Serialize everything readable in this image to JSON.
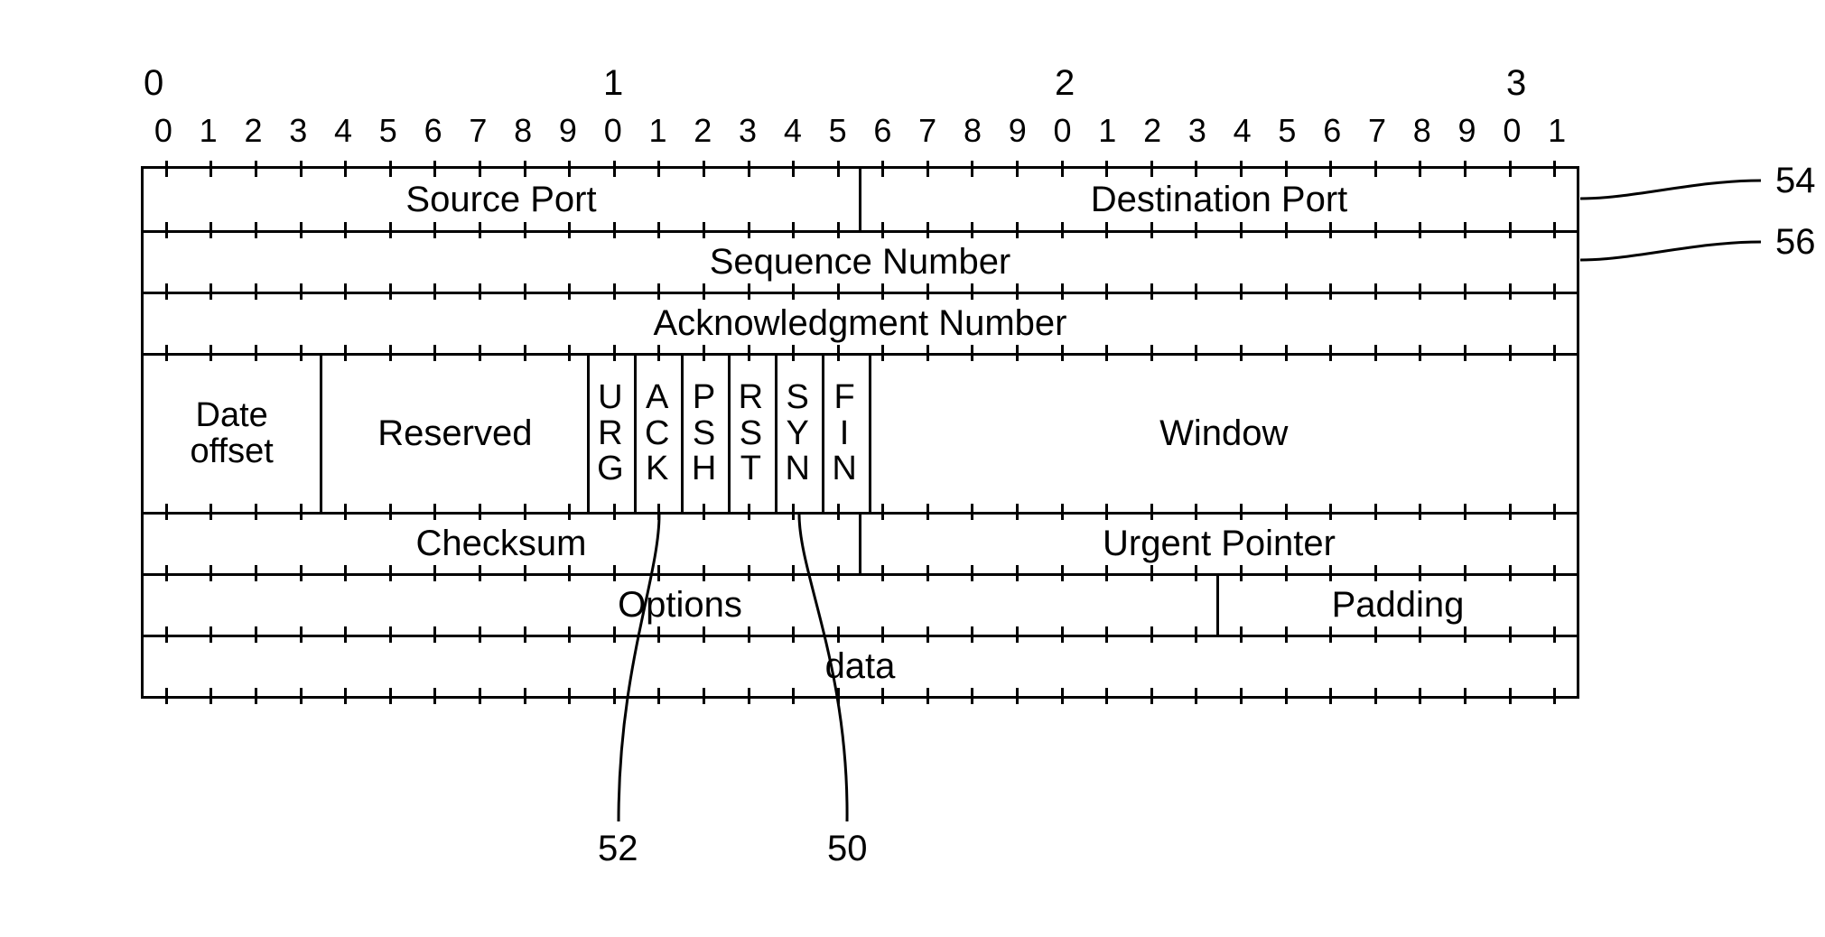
{
  "chart_data": {
    "type": "table",
    "description": "TCP segment header format, 32-bit-wide layout",
    "bit_width": 32,
    "bit_groups": [
      "0",
      "1",
      "2",
      "3"
    ],
    "bit_labels": [
      "0",
      "1",
      "2",
      "3",
      "4",
      "5",
      "6",
      "7",
      "8",
      "9",
      "0",
      "1",
      "2",
      "3",
      "4",
      "5",
      "6",
      "7",
      "8",
      "9",
      "0",
      "1",
      "2",
      "3",
      "4",
      "5",
      "6",
      "7",
      "8",
      "9",
      "0",
      "1"
    ],
    "rows": [
      {
        "fields": [
          {
            "name": "Source Port",
            "bits": 16
          },
          {
            "name": "Destination Port",
            "bits": 16
          }
        ]
      },
      {
        "fields": [
          {
            "name": "Sequence Number",
            "bits": 32
          }
        ]
      },
      {
        "fields": [
          {
            "name": "Acknowledgment Number",
            "bits": 32
          }
        ]
      },
      {
        "fields": [
          {
            "name": "Date offset",
            "bits": 4
          },
          {
            "name": "Reserved",
            "bits": 6
          },
          {
            "name": "URG",
            "bits": 1
          },
          {
            "name": "ACK",
            "bits": 1
          },
          {
            "name": "PSH",
            "bits": 1
          },
          {
            "name": "RST",
            "bits": 1
          },
          {
            "name": "SYN",
            "bits": 1
          },
          {
            "name": "FIN",
            "bits": 1
          },
          {
            "name": "Window",
            "bits": 16
          }
        ]
      },
      {
        "fields": [
          {
            "name": "Checksum",
            "bits": 16
          },
          {
            "name": "Urgent Pointer",
            "bits": 16
          }
        ]
      },
      {
        "fields": [
          {
            "name": "Options",
            "bits": 24
          },
          {
            "name": "Padding",
            "bits": 8
          }
        ]
      },
      {
        "fields": [
          {
            "name": "data",
            "bits": 32
          }
        ]
      }
    ],
    "callouts": {
      "syn": "50",
      "ack": "52",
      "row0_right": "54",
      "row1_right": "56"
    }
  },
  "labels": {
    "group0": "0",
    "group1": "1",
    "group2": "2",
    "group3": "3",
    "source_port": "Source Port",
    "dest_port": "Destination Port",
    "seq": "Sequence Number",
    "ackn": "Acknowledgment Number",
    "date_offset_l1": "Date",
    "date_offset_l2": "offset",
    "reserved": "Reserved",
    "urg1": "U",
    "urg2": "R",
    "urg3": "G",
    "ack1": "A",
    "ack2": "C",
    "ack3": "K",
    "psh1": "P",
    "psh2": "S",
    "psh3": "H",
    "rst1": "R",
    "rst2": "S",
    "rst3": "T",
    "syn1": "S",
    "syn2": "Y",
    "syn3": "N",
    "fin1": "F",
    "fin2": "I",
    "fin3": "N",
    "window": "Window",
    "checksum": "Checksum",
    "urgent": "Urgent Pointer",
    "options": "Options",
    "padding": "Padding",
    "data": "data",
    "c50": "50",
    "c52": "52",
    "c54": "54",
    "c56": "56"
  }
}
